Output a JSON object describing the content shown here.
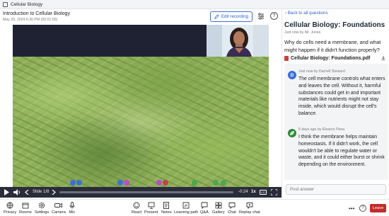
{
  "window": {
    "title": "Cellular Biology"
  },
  "header": {
    "recording_title": "Introduction to Cellular Biology",
    "recording_date": "May 20, 2024 6:30 PM (00:01:00)",
    "edit_label": "Edit recording"
  },
  "player": {
    "slide_label": "Slide 1/8",
    "time_remaining": "-0:24",
    "speed": "1x",
    "progress_fraction": 0.0
  },
  "panel": {
    "back_label": "Back to all questions",
    "question_title": "Cellular Biology: Foundations",
    "question_meta": "Just now by Mr. Jones",
    "question_text": "Why do cells need a membrane, and what might happen if it didn't function properly?",
    "attachment_name": "Cellular Biology: Foundations.pdf",
    "answers": [
      {
        "avatar_letter": "D",
        "avatar_color": "#3b6fd8",
        "meta": "Just now by Darnell Steward",
        "text": "The cell membrane controls what enters and leaves the cell. Without it, harmful substances could get in and important materials like nutrients might not stay inside, which would disrupt the cell's balance."
      },
      {
        "avatar_letter": "",
        "avatar_color": "#2f8a3b",
        "meta": "5 days ago by Eleanor Pena",
        "text": "I think the membrane helps maintain homeostasis. If it didn't work, the cell wouldn't be able to regulate water or waste, and it could either burst or shrink depending on the environment."
      }
    ],
    "post_placeholder": "Post answer"
  },
  "toolbar": {
    "left": [
      {
        "label": "Privacy",
        "icon": "globe-icon"
      },
      {
        "label": "Rooms",
        "icon": "rooms-icon"
      },
      {
        "label": "Settings",
        "icon": "gear-icon"
      },
      {
        "label": "Camera",
        "icon": "camera-icon"
      },
      {
        "label": "Mic",
        "icon": "mic-icon"
      }
    ],
    "center": [
      {
        "label": "React",
        "icon": "smile-icon"
      },
      {
        "label": "Present",
        "icon": "present-icon"
      },
      {
        "label": "Notes",
        "icon": "notes-icon"
      },
      {
        "label": "Learning path",
        "icon": "path-icon"
      },
      {
        "label": "Q&A",
        "icon": "qa-icon"
      },
      {
        "label": "Gallery",
        "icon": "gallery-icon"
      },
      {
        "label": "Chat",
        "icon": "chat-icon"
      },
      {
        "label": "Replay chat",
        "icon": "replay-chat-icon"
      }
    ],
    "leave_label": "Leave"
  },
  "colors": {
    "accent": "#3b6fd8",
    "leave": "#c42b2b",
    "control_bar": "#2a2c3a"
  }
}
